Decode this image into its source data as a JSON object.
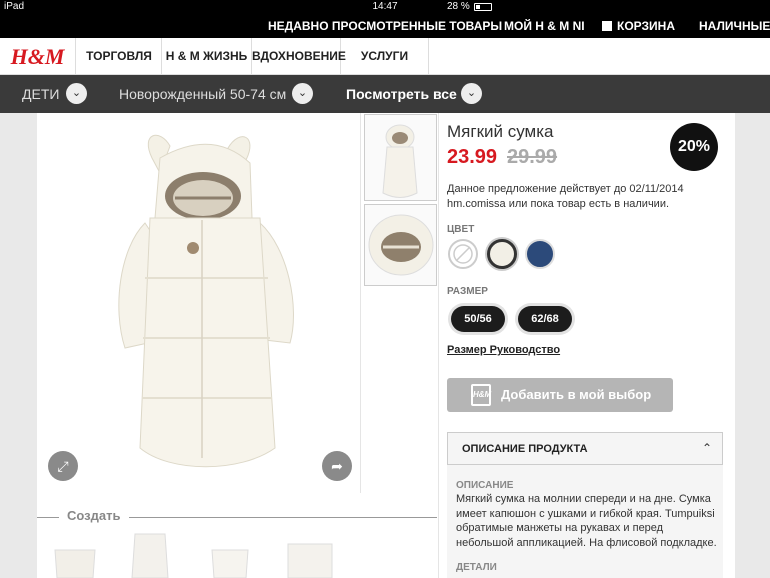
{
  "status": {
    "device": "iPad",
    "time": "14:47",
    "battery": "28 %",
    "battery_level": 0.28
  },
  "top_links": [
    "НЕДАВНО ПРОСМОТРЕННЫЕ ТОВАРЫ",
    "МОЙ H & M NI",
    "КОРЗИНА",
    "НАЛИЧНЫЕ"
  ],
  "nav": {
    "logo": "H&M",
    "items": [
      "ТОРГОВЛЯ",
      "H & M ЖИЗНЬ",
      "ВДОХНОВЕНИЕ",
      "УСЛУГИ"
    ]
  },
  "breadcrumb": [
    "ДЕТИ",
    "Новорожденный 50-74 см",
    "Посмотреть все"
  ],
  "product": {
    "title": "Мягкий сумка",
    "price": "23.99",
    "old_price": "29.99",
    "discount": "20%",
    "offer": "Данное предложение действует до 02/11/2014 hm.comissa или пока товар есть в наличии.",
    "color_label": "ЦВЕТ",
    "colors": [
      "#ffffff",
      "#f2efe6",
      "#2c4a7a"
    ],
    "size_label": "РАЗМЕР",
    "sizes": [
      "50/56",
      "62/68"
    ],
    "size_guide": "Размер Руководство",
    "add_button": "Добавить в мой выбор",
    "description_header": "ОПИСАНИЕ ПРОДУКТА",
    "description_label": "ОПИСАНИЕ",
    "description": "Мягкий сумка на молнии спереди и на дне. Сумка имеет капюшон с ушками и гибкой края. Tumpuiksi обратимые манжеты на рукавах и перед небольшой аппликацией. На флисовой подкладке.",
    "details_label": "ДЕТАЛИ"
  },
  "create_label": "Создать",
  "colors": {
    "accent": "#d71920",
    "dark": "#000000",
    "crumb_bg": "#3a3a3a"
  }
}
